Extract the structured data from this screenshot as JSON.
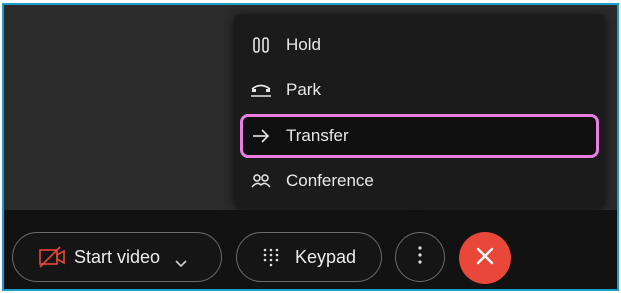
{
  "menu": {
    "items": [
      {
        "label": "Hold",
        "icon": "hold-icon"
      },
      {
        "label": "Park",
        "icon": "park-icon"
      },
      {
        "label": "Transfer",
        "icon": "arrow-right-icon"
      },
      {
        "label": "Conference",
        "icon": "conference-icon"
      }
    ],
    "highlighted": "Transfer"
  },
  "controls": {
    "start_video_label": "Start video",
    "keypad_label": "Keypad"
  },
  "colors": {
    "frame_border": "#1aa0c9",
    "highlight_outline": "#e87ee0",
    "end_call": "#e8473a",
    "video_icon": "#e8473a"
  }
}
